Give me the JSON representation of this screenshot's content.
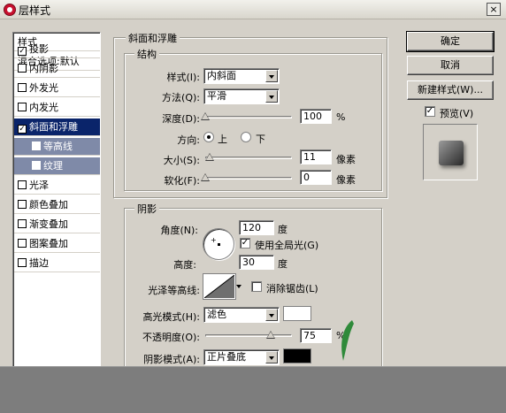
{
  "title": "层样式",
  "close_label": "×",
  "style_list": {
    "header": "样式",
    "blend_options": "混合选项:默认",
    "items": [
      {
        "label": "投影",
        "checked": true
      },
      {
        "label": "内阴影",
        "checked": false
      },
      {
        "label": "外发光",
        "checked": false
      },
      {
        "label": "内发光",
        "checked": false
      },
      {
        "label": "斜面和浮雕",
        "checked": true,
        "selected": true
      },
      {
        "label": "等高线",
        "checked": false,
        "sub": true
      },
      {
        "label": "纹理",
        "checked": false,
        "sub": true
      },
      {
        "label": "光泽",
        "checked": false
      },
      {
        "label": "颜色叠加",
        "checked": false
      },
      {
        "label": "渐变叠加",
        "checked": false
      },
      {
        "label": "图案叠加",
        "checked": false
      },
      {
        "label": "描边",
        "checked": false
      }
    ]
  },
  "bevel": {
    "section_title": "斜面和浮雕",
    "structure_title": "结构",
    "style_label": "样式(I):",
    "style_value": "内斜面",
    "technique_label": "方法(Q):",
    "technique_value": "平滑",
    "depth_label": "深度(D):",
    "depth_value": "100",
    "depth_unit": "%",
    "depth_fraction": 0.0,
    "direction_label": "方向:",
    "direction_up": "上",
    "direction_down": "下",
    "size_label": "大小(S):",
    "size_value": "11",
    "size_unit": "像素",
    "size_fraction": 0.05,
    "soften_label": "软化(F):",
    "soften_value": "0",
    "soften_unit": "像素",
    "soften_fraction": 0.0
  },
  "shading": {
    "title": "阴影",
    "angle_label": "角度(N):",
    "angle_value": "120",
    "angle_unit": "度",
    "global_light_label": "使用全局光(G)",
    "global_light_checked": true,
    "altitude_label": "高度:",
    "altitude_value": "30",
    "altitude_unit": "度",
    "gloss_contour_label": "光泽等高线:",
    "anti_alias_label": "消除锯齿(L)",
    "highlight_mode_label": "高光模式(H):",
    "highlight_mode_value": "滤色",
    "highlight_color": "#ffffff",
    "opacity_label": "不透明度(O):",
    "opacity_value": "75",
    "opacity_unit": "%",
    "opacity_fraction": 0.75,
    "shadow_mode_label": "阴影模式(A):",
    "shadow_mode_value": "正片叠底",
    "shadow_color": "#000000"
  },
  "buttons": {
    "ok": "确定",
    "cancel": "取消",
    "new_style": "新建样式(W)...",
    "preview_label": "预览(V)",
    "preview_checked": true
  }
}
